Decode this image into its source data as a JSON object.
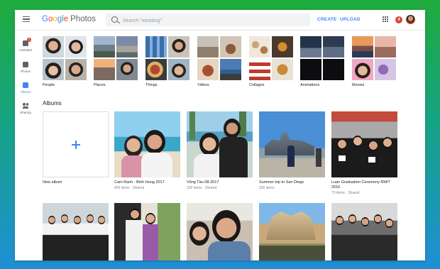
{
  "header": {
    "logo_letters": [
      "G",
      "o",
      "o",
      "g",
      "l",
      "e"
    ],
    "logo_product": "Photos",
    "search_placeholder": "Search \"wedding\"",
    "create_label": "CREATE",
    "upload_label": "UPLOAD",
    "notification_count": "4"
  },
  "sidebar": {
    "items": [
      {
        "label": "Assistant",
        "badge": "2"
      },
      {
        "label": "Photos"
      },
      {
        "label": "Albums"
      },
      {
        "label": "Sharing"
      }
    ]
  },
  "categories": [
    {
      "label": "People"
    },
    {
      "label": "Places"
    },
    {
      "label": "Things"
    },
    {
      "label": "Videos"
    },
    {
      "label": "Collages"
    },
    {
      "label": "Animations"
    },
    {
      "label": "Movies"
    }
  ],
  "albums_section_title": "Albums",
  "albums": [
    {
      "title": "New album",
      "meta": ""
    },
    {
      "title": "Cam Ranh - Binh Hung 2017",
      "meta": "426 items · Shared"
    },
    {
      "title": "Vũng Tàu 08-2017",
      "meta": "100 items · Shared"
    },
    {
      "title": "Summer trip to San Diego",
      "meta": "200 items"
    },
    {
      "title": "Luan Graduation Ceremony RMIT 2016",
      "meta": "73 items · Shared"
    }
  ],
  "colors": {
    "accent": "#4285f4",
    "badge": "#db4437",
    "background_gradient": [
      "#1faa3c",
      "#16a383",
      "#1f8fd6"
    ]
  }
}
